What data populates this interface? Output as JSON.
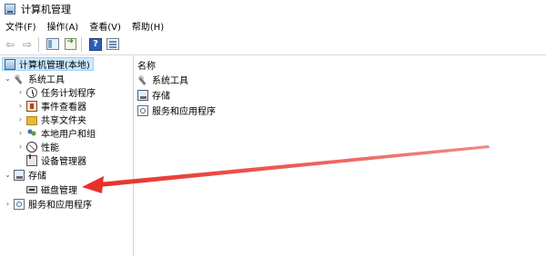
{
  "window": {
    "title": "计算机管理"
  },
  "menu": [
    {
      "label": "文件(F)"
    },
    {
      "label": "操作(A)"
    },
    {
      "label": "查看(V)"
    },
    {
      "label": "帮助(H)"
    }
  ],
  "toolbar": {
    "help_label": "?"
  },
  "tree": {
    "root_label": "计算机管理(本地)",
    "system_tools": "系统工具",
    "task_scheduler": "任务计划程序",
    "event_viewer": "事件查看器",
    "shared_folders": "共享文件夹",
    "local_users": "本地用户和组",
    "performance": "性能",
    "device_manager": "设备管理器",
    "storage": "存储",
    "disk_management": "磁盘管理",
    "services_apps": "服务和应用程序"
  },
  "list": {
    "column_name": "名称",
    "items": [
      "系统工具",
      "存储",
      "服务和应用程序"
    ]
  },
  "colors": {
    "selection_bg": "#cce8ff",
    "annotation_red": "#e8302a"
  }
}
